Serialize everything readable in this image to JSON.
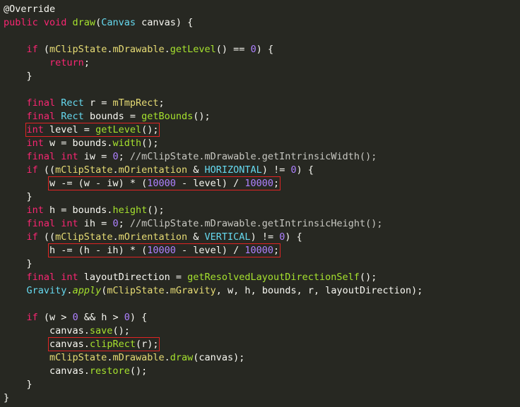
{
  "colors": {
    "background": "#272822",
    "plain": "#f8f8f2",
    "keyword": "#f92672",
    "type": "#66d9ef",
    "function": "#a6e22e",
    "field": "#e6db74",
    "number": "#ae81ff",
    "comment": "#c8c8c2",
    "constant": "#66d9ef",
    "highlight_box": "#e02424"
  },
  "code_lines": [
    [
      [
        "annotation",
        "@Override"
      ]
    ],
    [
      [
        "keyword",
        "public void "
      ],
      [
        "function",
        "draw"
      ],
      [
        "plain",
        "("
      ],
      [
        "type",
        "Canvas"
      ],
      [
        "plain",
        " canvas) {"
      ]
    ],
    [],
    [
      [
        "plain",
        "    "
      ],
      [
        "keyword",
        "if"
      ],
      [
        "plain",
        " ("
      ],
      [
        "field",
        "mClipState"
      ],
      [
        "plain",
        "."
      ],
      [
        "field",
        "mDrawable"
      ],
      [
        "plain",
        "."
      ],
      [
        "function",
        "getLevel"
      ],
      [
        "plain",
        "() == "
      ],
      [
        "number",
        "0"
      ],
      [
        "plain",
        ") {"
      ]
    ],
    [
      [
        "plain",
        "        "
      ],
      [
        "keyword",
        "return"
      ],
      [
        "plain",
        ";"
      ]
    ],
    [
      [
        "plain",
        "    }"
      ]
    ],
    [],
    [
      [
        "plain",
        "    "
      ],
      [
        "keyword",
        "final "
      ],
      [
        "type",
        "Rect"
      ],
      [
        "plain",
        " r = "
      ],
      [
        "field",
        "mTmpRect"
      ],
      [
        "plain",
        ";"
      ]
    ],
    [
      [
        "plain",
        "    "
      ],
      [
        "keyword",
        "final "
      ],
      [
        "type",
        "Rect"
      ],
      [
        "plain",
        " bounds = "
      ],
      [
        "function",
        "getBounds"
      ],
      [
        "plain",
        "();"
      ]
    ],
    [
      [
        "plain",
        "    "
      ],
      [
        "hl",
        [
          [
            "keyword",
            "int"
          ],
          [
            "plain",
            " level = "
          ],
          [
            "function",
            "getLevel"
          ],
          [
            "plain",
            "();"
          ]
        ]
      ]
    ],
    [
      [
        "plain",
        "    "
      ],
      [
        "keyword",
        "int"
      ],
      [
        "plain",
        " w = bounds."
      ],
      [
        "function",
        "width"
      ],
      [
        "plain",
        "();"
      ]
    ],
    [
      [
        "plain",
        "    "
      ],
      [
        "keyword",
        "final int"
      ],
      [
        "plain",
        " iw = "
      ],
      [
        "number",
        "0"
      ],
      [
        "plain",
        "; "
      ],
      [
        "comment",
        "//mClipState.mDrawable.getIntrinsicWidth();"
      ]
    ],
    [
      [
        "plain",
        "    "
      ],
      [
        "keyword",
        "if"
      ],
      [
        "plain",
        " (("
      ],
      [
        "field",
        "mClipState"
      ],
      [
        "plain",
        "."
      ],
      [
        "field",
        "mOrientation"
      ],
      [
        "plain",
        " & "
      ],
      [
        "constant",
        "HORIZONTAL"
      ],
      [
        "plain",
        ") != "
      ],
      [
        "number",
        "0"
      ],
      [
        "plain",
        ") {"
      ]
    ],
    [
      [
        "plain",
        "        "
      ],
      [
        "hl",
        [
          [
            "plain",
            "w -= (w - iw) * ("
          ],
          [
            "number",
            "10000"
          ],
          [
            "plain",
            " - level) / "
          ],
          [
            "number",
            "10000"
          ],
          [
            "plain",
            ";"
          ]
        ]
      ]
    ],
    [
      [
        "plain",
        "    }"
      ]
    ],
    [
      [
        "plain",
        "    "
      ],
      [
        "keyword",
        "int"
      ],
      [
        "plain",
        " h = bounds."
      ],
      [
        "function",
        "height"
      ],
      [
        "plain",
        "();"
      ]
    ],
    [
      [
        "plain",
        "    "
      ],
      [
        "keyword",
        "final int"
      ],
      [
        "plain",
        " ih = "
      ],
      [
        "number",
        "0"
      ],
      [
        "plain",
        "; "
      ],
      [
        "comment",
        "//mClipState.mDrawable.getIntrinsicHeight();"
      ]
    ],
    [
      [
        "plain",
        "    "
      ],
      [
        "keyword",
        "if"
      ],
      [
        "plain",
        " (("
      ],
      [
        "field",
        "mClipState"
      ],
      [
        "plain",
        "."
      ],
      [
        "field",
        "mOrientation"
      ],
      [
        "plain",
        " & "
      ],
      [
        "constant",
        "VERTICAL"
      ],
      [
        "plain",
        ") != "
      ],
      [
        "number",
        "0"
      ],
      [
        "plain",
        ") {"
      ]
    ],
    [
      [
        "plain",
        "        "
      ],
      [
        "hl",
        [
          [
            "plain",
            "h -= (h - ih) * ("
          ],
          [
            "number",
            "10000"
          ],
          [
            "plain",
            " - level) / "
          ],
          [
            "number",
            "10000"
          ],
          [
            "plain",
            ";"
          ]
        ]
      ]
    ],
    [
      [
        "plain",
        "    }"
      ]
    ],
    [
      [
        "plain",
        "    "
      ],
      [
        "keyword",
        "final int"
      ],
      [
        "plain",
        " layoutDirection = "
      ],
      [
        "function",
        "getResolvedLayoutDirectionSelf"
      ],
      [
        "plain",
        "();"
      ]
    ],
    [
      [
        "plain",
        "    "
      ],
      [
        "type",
        "Gravity"
      ],
      [
        "plain",
        "."
      ],
      [
        "italic",
        "apply"
      ],
      [
        "plain",
        "("
      ],
      [
        "field",
        "mClipState"
      ],
      [
        "plain",
        "."
      ],
      [
        "field",
        "mGravity"
      ],
      [
        "plain",
        ", w, h, bounds, r, layoutDirection);"
      ]
    ],
    [],
    [
      [
        "plain",
        "    "
      ],
      [
        "keyword",
        "if"
      ],
      [
        "plain",
        " (w > "
      ],
      [
        "number",
        "0"
      ],
      [
        "plain",
        " && h > "
      ],
      [
        "number",
        "0"
      ],
      [
        "plain",
        ") {"
      ]
    ],
    [
      [
        "plain",
        "        canvas."
      ],
      [
        "function",
        "save"
      ],
      [
        "plain",
        "();"
      ]
    ],
    [
      [
        "plain",
        "        "
      ],
      [
        "hl",
        [
          [
            "plain",
            "canvas."
          ],
          [
            "function",
            "clipRect"
          ],
          [
            "plain",
            "(r);"
          ]
        ]
      ]
    ],
    [
      [
        "plain",
        "        "
      ],
      [
        "field",
        "mClipState"
      ],
      [
        "plain",
        "."
      ],
      [
        "field",
        "mDrawable"
      ],
      [
        "plain",
        "."
      ],
      [
        "function",
        "draw"
      ],
      [
        "plain",
        "(canvas);"
      ]
    ],
    [
      [
        "plain",
        "        canvas."
      ],
      [
        "function",
        "restore"
      ],
      [
        "plain",
        "();"
      ]
    ],
    [
      [
        "plain",
        "    }"
      ]
    ],
    [
      [
        "plain",
        "}"
      ]
    ]
  ]
}
